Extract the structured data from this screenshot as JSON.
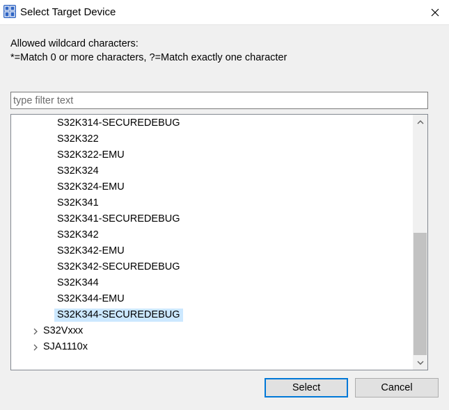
{
  "window": {
    "title": "Select Target Device",
    "icon": "s32ds-app-icon",
    "close_icon": "close-icon"
  },
  "info": {
    "line1": "Allowed wildcard characters:",
    "line2": "*=Match 0 or more characters, ?=Match exactly one character"
  },
  "filter": {
    "placeholder": "type filter text",
    "value": ""
  },
  "tree": {
    "items": [
      {
        "label": "S32K314-SECUREDEBUG",
        "level": 2,
        "expandable": false,
        "selected": false
      },
      {
        "label": "S32K322",
        "level": 2,
        "expandable": false,
        "selected": false
      },
      {
        "label": "S32K322-EMU",
        "level": 2,
        "expandable": false,
        "selected": false
      },
      {
        "label": "S32K324",
        "level": 2,
        "expandable": false,
        "selected": false
      },
      {
        "label": "S32K324-EMU",
        "level": 2,
        "expandable": false,
        "selected": false
      },
      {
        "label": "S32K341",
        "level": 2,
        "expandable": false,
        "selected": false
      },
      {
        "label": "S32K341-SECUREDEBUG",
        "level": 2,
        "expandable": false,
        "selected": false
      },
      {
        "label": "S32K342",
        "level": 2,
        "expandable": false,
        "selected": false
      },
      {
        "label": "S32K342-EMU",
        "level": 2,
        "expandable": false,
        "selected": false
      },
      {
        "label": "S32K342-SECUREDEBUG",
        "level": 2,
        "expandable": false,
        "selected": false
      },
      {
        "label": "S32K344",
        "level": 2,
        "expandable": false,
        "selected": false
      },
      {
        "label": "S32K344-EMU",
        "level": 2,
        "expandable": false,
        "selected": false
      },
      {
        "label": "S32K344-SECUREDEBUG",
        "level": 2,
        "expandable": false,
        "selected": true
      },
      {
        "label": "S32Vxxx",
        "level": 1,
        "expandable": true,
        "selected": false
      },
      {
        "label": "SJA1110x",
        "level": 1,
        "expandable": true,
        "selected": false
      }
    ]
  },
  "scrollbar": {
    "up_icon": "chevron-up-icon",
    "down_icon": "chevron-down-icon"
  },
  "buttons": {
    "select": "Select",
    "cancel": "Cancel"
  },
  "colors": {
    "selection": "#cce8ff",
    "default_button_border": "#0078d7",
    "dialog_background": "#f0f0f0",
    "app_icon": "#2f65c4"
  }
}
